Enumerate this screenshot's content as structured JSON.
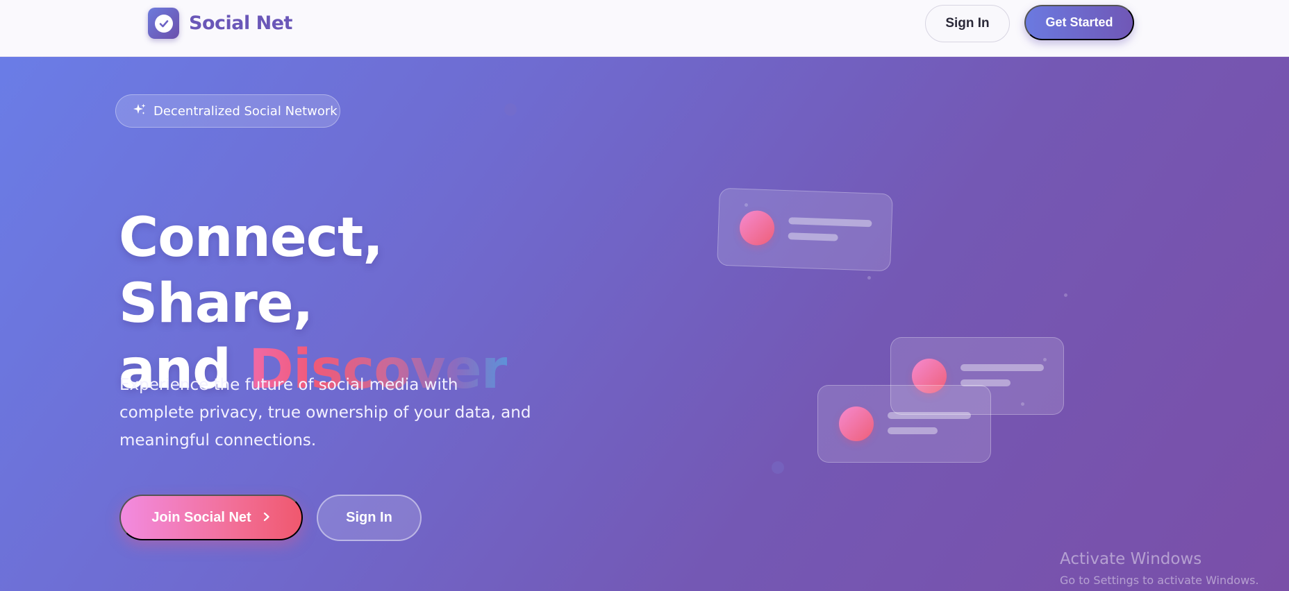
{
  "navbar": {
    "brand": "Social Net",
    "logo_icon": "check-circle-icon",
    "sign_in_label": "Sign In",
    "get_started_label": "Get Started"
  },
  "hero": {
    "tag": {
      "icon": "sparkles-icon",
      "label": "Decentralized Social Network"
    },
    "headline": {
      "line1": "Connect, Share,",
      "line2_prefix": "and",
      "line2_accent": "Discover"
    },
    "subtext": "Experience the future of social media with complete privacy, true ownership of your data, and meaningful connections.",
    "primary_button": {
      "label": "Join Social Net",
      "icon": "chevron-right-icon"
    },
    "secondary_button": {
      "label": "Sign In"
    }
  },
  "watermark": {
    "title": "Activate Windows",
    "subtitle": "Go to Settings to activate Windows."
  },
  "colors": {
    "brand_purple": "#6a57b8",
    "hero_gradient_start": "#6a7ee8",
    "hero_gradient_end": "#7a4fa8",
    "accent_pink": "#f0586e"
  }
}
